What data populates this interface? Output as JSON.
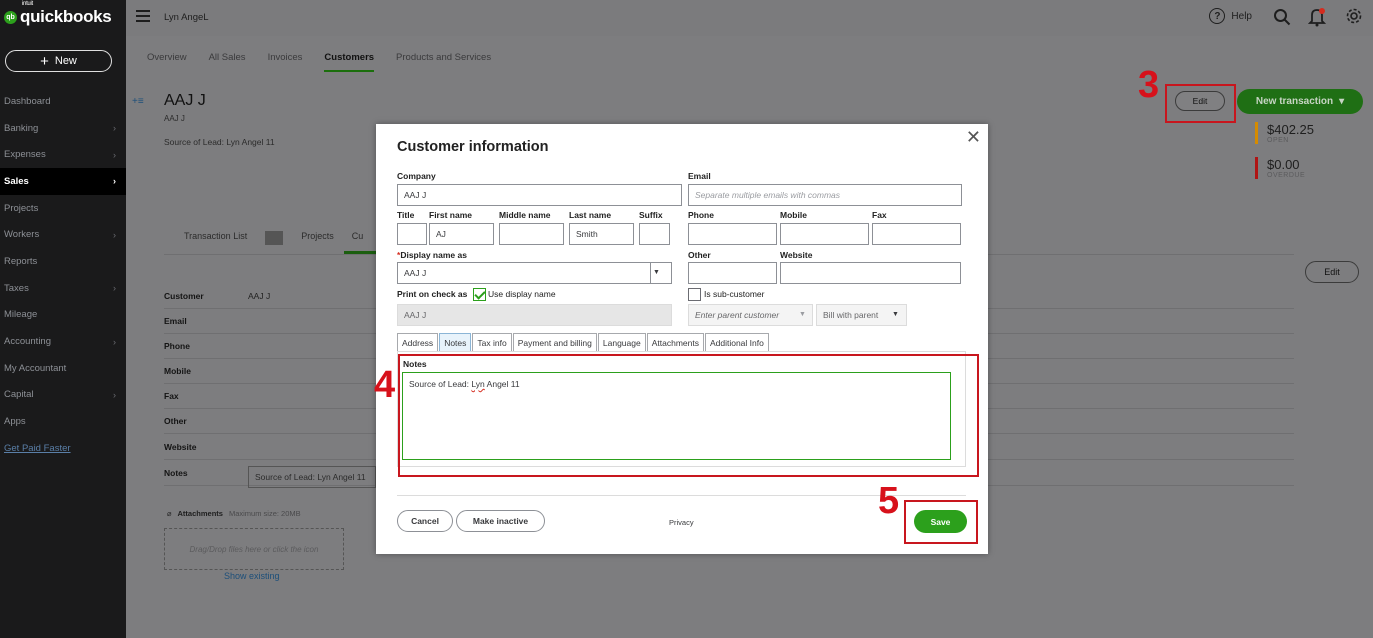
{
  "app": {
    "logo_intuit": "intuit",
    "logo_text": "quickbooks",
    "new_label": "New",
    "company": "Lyn AngeL",
    "help_label": "Help"
  },
  "sidebar": {
    "items": [
      {
        "label": "Dashboard",
        "chevron": false,
        "active": false
      },
      {
        "label": "Banking",
        "chevron": true,
        "active": false
      },
      {
        "label": "Expenses",
        "chevron": true,
        "active": false
      },
      {
        "label": "Sales",
        "chevron": true,
        "active": true
      },
      {
        "label": "Projects",
        "chevron": false,
        "active": false
      },
      {
        "label": "Workers",
        "chevron": true,
        "active": false
      },
      {
        "label": "Reports",
        "chevron": false,
        "active": false
      },
      {
        "label": "Taxes",
        "chevron": true,
        "active": false
      },
      {
        "label": "Mileage",
        "chevron": false,
        "active": false
      },
      {
        "label": "Accounting",
        "chevron": true,
        "active": false
      },
      {
        "label": "My Accountant",
        "chevron": false,
        "active": false
      },
      {
        "label": "Capital",
        "chevron": true,
        "active": false
      },
      {
        "label": "Apps",
        "chevron": false,
        "active": false
      },
      {
        "label": "Get Paid Faster",
        "chevron": false,
        "active": false
      }
    ]
  },
  "subtabs": [
    "Overview",
    "All Sales",
    "Invoices",
    "Customers",
    "Products and Services"
  ],
  "subtab_active": "Customers",
  "customer": {
    "name": "AAJ J",
    "sub": "AAJ J",
    "lead": "Source of Lead:  Lyn Angel 11",
    "edit_label": "Edit",
    "new_transaction_label": "New transaction",
    "open_amount": "$402.25",
    "open_label": "OPEN",
    "overdue_amount": "$0.00",
    "overdue_label": "OVERDUE",
    "detail_tabs": [
      "Transaction List",
      "Projects",
      "Cu"
    ],
    "edit2_label": "Edit",
    "rows": [
      {
        "label": "Customer",
        "value": "AAJ J"
      },
      {
        "label": "Email",
        "value": ""
      },
      {
        "label": "Phone",
        "value": ""
      },
      {
        "label": "Mobile",
        "value": ""
      },
      {
        "label": "Fax",
        "value": ""
      },
      {
        "label": "Other",
        "value": ""
      },
      {
        "label": "Website",
        "value": ""
      },
      {
        "label": "Notes",
        "value": "Source of Lead:  Lyn Angel 11"
      }
    ],
    "attachments_label": "Attachments",
    "attachments_max": "Maximum size: 20MB",
    "dropzone": "Drag/Drop files here or click the icon",
    "show_existing": "Show existing"
  },
  "annotations": {
    "step3": "3",
    "step4": "4",
    "step5": "5",
    "color": "#c8161e"
  },
  "modal": {
    "title": "Customer information",
    "company_label": "Company",
    "company_value": "AAJ J",
    "email_label": "Email",
    "email_placeholder": "Separate multiple emails with commas",
    "title_label": "Title",
    "first_label": "First name",
    "first_value": "AJ",
    "middle_label": "Middle name",
    "last_label": "Last name",
    "last_value": "Smith",
    "suffix_label": "Suffix",
    "phone_label": "Phone",
    "mobile_label": "Mobile",
    "fax_label": "Fax",
    "display_label": "Display name as",
    "display_value": "AAJ J",
    "other_label": "Other",
    "website_label": "Website",
    "print_label": "Print on check as",
    "use_display_label": "Use display name",
    "print_value": "AAJ J",
    "sub_customer_label": "Is sub-customer",
    "parent_placeholder": "Enter parent customer",
    "bill_with_parent": "Bill with parent",
    "tabs": [
      "Address",
      "Notes",
      "Tax info",
      "Payment and billing",
      "Language",
      "Attachments",
      "Additional Info"
    ],
    "tab_active": "Notes",
    "notes_label": "Notes",
    "notes_prefix": "Source of Lead:  ",
    "notes_misspelled": "Lyn",
    "notes_suffix": " Angel 11",
    "cancel_label": "Cancel",
    "make_inactive_label": "Make inactive",
    "privacy_label": "Privacy",
    "save_label": "Save"
  }
}
